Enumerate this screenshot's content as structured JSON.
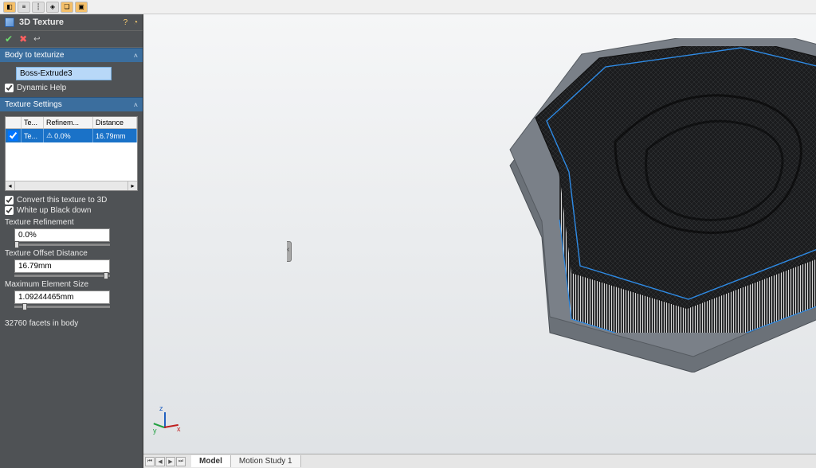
{
  "toolbar_icons": [
    "palette",
    "tree",
    "hierarchy",
    "target",
    "layers",
    "cube"
  ],
  "panel": {
    "title": "3D Texture",
    "body_section": "Body to texturize",
    "body_selection": "Boss-Extrude3",
    "dynamic_help": "Dynamic Help",
    "texture_settings": "Texture Settings",
    "table": {
      "headers": {
        "te": "Te...",
        "refinement": "Refinem...",
        "distance": "Distance"
      },
      "row": {
        "te": "Te...",
        "refinement": "0.0%",
        "distance": "16.79mm"
      }
    },
    "convert": "Convert this texture to 3D",
    "whiteup": "White up Black down",
    "refine_label": "Texture Refinement",
    "refine_value": "0.0%",
    "offset_label": "Texture Offset Distance",
    "offset_value": "16.79mm",
    "maxel_label": "Maximum Element Size",
    "maxel_value": "1.09244465mm",
    "facets": "32760 facets in body"
  },
  "triad": {
    "x": "x",
    "y": "y",
    "z": "z"
  },
  "tabs": {
    "model": "Model",
    "motion": "Motion Study 1"
  }
}
